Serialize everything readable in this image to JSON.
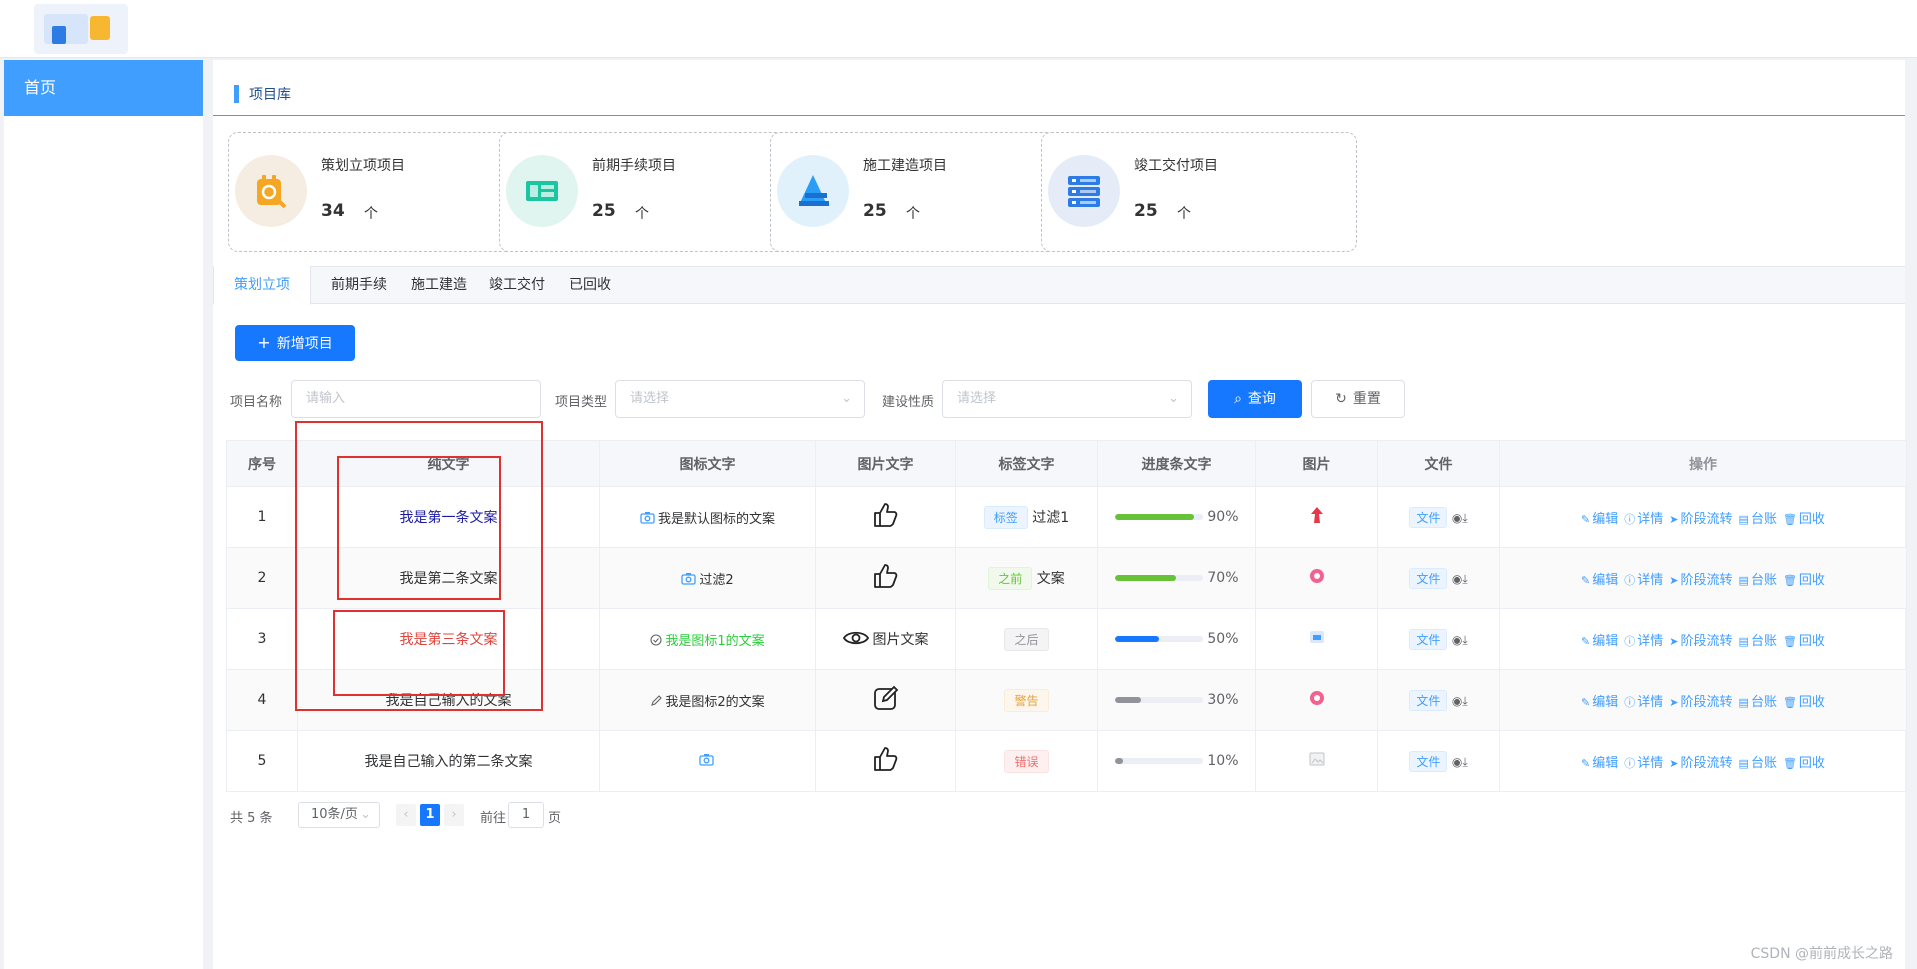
{
  "header": {
    "logo": "app-logo"
  },
  "sidebar": {
    "items": [
      {
        "label": "首页"
      }
    ]
  },
  "breadcrumb": {
    "title": "项目库"
  },
  "cards": [
    {
      "name": "策划立项项目",
      "count": "34",
      "unit": "个",
      "icon": "plan-icon",
      "bg": "#f5ede1",
      "color": "#f5a623"
    },
    {
      "name": "前期手续项目",
      "count": "25",
      "unit": "个",
      "icon": "blueprint-icon",
      "bg": "#e1f5f0",
      "color": "#19c6a0"
    },
    {
      "name": "施工建造项目",
      "count": "25",
      "unit": "个",
      "icon": "construction-icon",
      "bg": "#e1f1fb",
      "color": "#2a9df4"
    },
    {
      "name": "竣工交付项目",
      "count": "25",
      "unit": "个",
      "icon": "server-icon",
      "bg": "#e5ecf8",
      "color": "#2d7be5"
    }
  ],
  "tabs": [
    "策划立项",
    "前期手续",
    "施工建造",
    "竣工交付",
    "已回收"
  ],
  "toolbar": {
    "add_label": "新增项目"
  },
  "filters": {
    "name_label": "项目名称",
    "name_placeholder": "请输入",
    "type_label": "项目类型",
    "type_placeholder": "请选择",
    "nature_label": "建设性质",
    "nature_placeholder": "请选择",
    "query_label": "查询",
    "reset_label": "重置"
  },
  "table": {
    "headers": [
      "序号",
      "纯文字",
      "图标文字",
      "图片文字",
      "标签文字",
      "进度条文字",
      "图片",
      "文件",
      "操作"
    ],
    "rows": [
      {
        "idx": "1",
        "text": "我是第一条文案",
        "text_color": "#1a1aa6",
        "icon_text": "我是默认图标的文案",
        "icon_text_color": "#303133",
        "img_text": "",
        "tag": "标签",
        "tag_type": "blue",
        "tag_text": "过滤1",
        "progress": 90,
        "progress_color": "#67c23a",
        "pct": "90%",
        "file": "文件"
      },
      {
        "idx": "2",
        "text": "我是第二条文案",
        "text_color": "#303133",
        "icon_text": "过滤2",
        "icon_text_color": "#303133",
        "img_text": "",
        "tag": "之前",
        "tag_type": "green",
        "tag_text": "文案",
        "progress": 70,
        "progress_color": "#67c23a",
        "pct": "70%",
        "file": "文件"
      },
      {
        "idx": "3",
        "text": "我是第三条文案",
        "text_color": "#e0443e",
        "icon_text": "我是图标1的文案",
        "icon_text_color": "#2bcd3a",
        "img_text": "图片文案",
        "tag": "之后",
        "tag_type": "gray",
        "tag_text": "",
        "progress": 50,
        "progress_color": "#1677ff",
        "pct": "50%",
        "file": "文件"
      },
      {
        "idx": "4",
        "text": "我是自己输入的文案",
        "text_color": "#303133",
        "icon_text": "我是图标2的文案",
        "icon_text_color": "#303133",
        "img_text": "",
        "tag": "警告",
        "tag_type": "orange",
        "tag_text": "",
        "progress": 30,
        "progress_color": "#909399",
        "pct": "30%",
        "file": "文件"
      },
      {
        "idx": "5",
        "text": "我是自己输入的第二条文案",
        "text_color": "#303133",
        "icon_text": "",
        "icon_text_color": "#303133",
        "img_text": "",
        "tag": "错误",
        "tag_type": "red",
        "tag_text": "",
        "progress": 10,
        "progress_color": "#909399",
        "pct": "10%",
        "file": "文件"
      }
    ],
    "ops": [
      "编辑",
      "详情",
      "阶段流转",
      "台账",
      "回收"
    ]
  },
  "pager": {
    "total": "共 5 条",
    "size": "10条/页",
    "page": "1",
    "goto": "前往",
    "goto_val": "1",
    "page_unit": "页"
  },
  "watermark": "CSDN @前前成长之路"
}
